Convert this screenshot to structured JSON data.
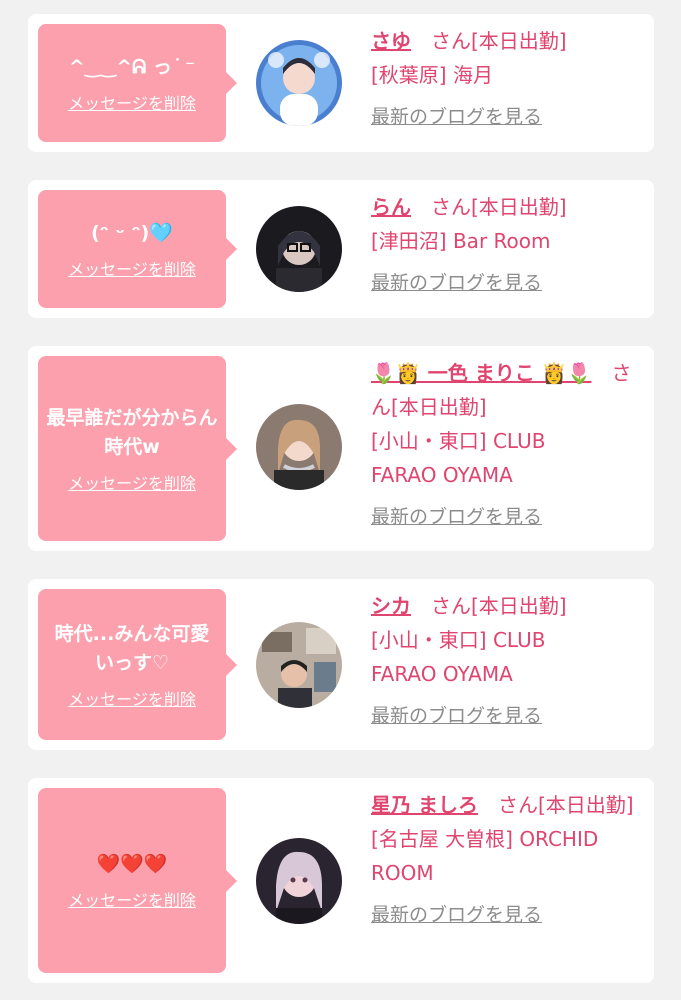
{
  "delete_label": "メッセージを削除",
  "blog_label": "最新のブログを見る",
  "honorific": "さん",
  "status": "[本日出勤]",
  "cards": [
    {
      "message": "^‿‿^ᕱ っ ͘ ⁻",
      "name": "さゆ",
      "shop_line1": "[秋葉原] 海月",
      "shop_line2": ""
    },
    {
      "message": "(ᵔ ᵕ ᵔ)🩵",
      "name": "らん",
      "shop_line1": "[津田沼] Bar Room",
      "shop_line2": ""
    },
    {
      "message": "最早誰だが分からん時代w",
      "name": "🌷👸 一色 まりこ 👸🌷",
      "shop_line1": "[小山・東口] CLUB",
      "shop_line2": "FARAO OYAMA"
    },
    {
      "message": "時代...みんな可愛いっす♡",
      "name": "シカ",
      "shop_line1": "[小山・東口] CLUB",
      "shop_line2": "FARAO OYAMA"
    },
    {
      "message": "❤️❤️❤️",
      "name": "星乃 ましろ",
      "shop_line1": "[名古屋 大曽根] ORCHID",
      "shop_line2": "ROOM"
    }
  ],
  "colors": {
    "accent": "#e0456f",
    "bubble": "#fca0ad",
    "muted": "#8c8c8c"
  }
}
